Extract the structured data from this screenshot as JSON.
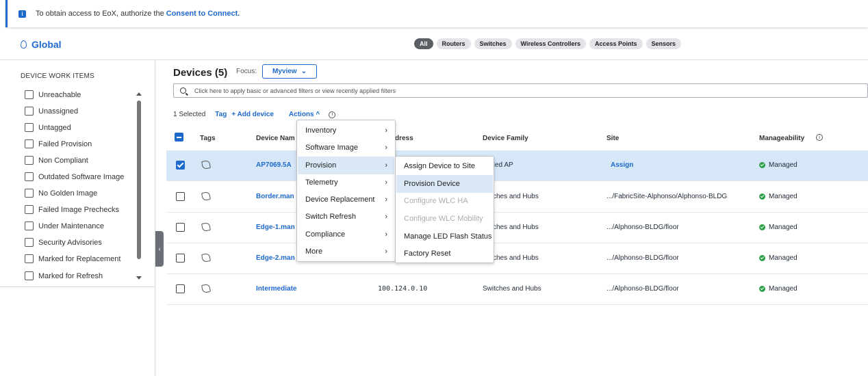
{
  "banner": {
    "text": "To obtain access to EoX, authorize the",
    "link": "Consent to Connect."
  },
  "location": {
    "label": "Global"
  },
  "filters": [
    "All",
    "Routers",
    "Switches",
    "Wireless Controllers",
    "Access Points",
    "Sensors"
  ],
  "sidebar": {
    "heading": "DEVICE WORK ITEMS",
    "items": [
      "Unreachable",
      "Unassigned",
      "Untagged",
      "Failed Provision",
      "Non Compliant",
      "Outdated Software Image",
      "No Golden Image",
      "Failed Image Prechecks",
      "Under Maintenance",
      "Security Advisories",
      "Marked for Replacement",
      "Marked for Refresh"
    ]
  },
  "main": {
    "title": "Devices (5)",
    "focus_label": "Focus:",
    "focus_value": "Myview",
    "search_placeholder": "Click here to apply basic or advanced filters or view recently applied filters",
    "selected": "1 Selected",
    "tag": "Tag",
    "add_device": "+ Add device",
    "actions": "Actions ^"
  },
  "table": {
    "headers": {
      "tags": "Tags",
      "device_name": "Device Nam",
      "ip": "dress",
      "family": "Device Family",
      "site": "Site",
      "manageability": "Manageability"
    },
    "rows": [
      {
        "name": "AP7069.5A",
        "ip": "",
        "family": "fied AP",
        "site": "Assign",
        "status": "Managed"
      },
      {
        "name": "Border.man",
        "ip": "",
        "family": "itches and Hubs",
        "site": ".../FabricSite-Alphonso/Alphonso-BLDG",
        "status": "Managed"
      },
      {
        "name": "Edge-1.man",
        "ip": "",
        "family": "itches and Hubs",
        "site": ".../Alphonso-BLDG/floor",
        "status": "Managed"
      },
      {
        "name": "Edge-2.man",
        "ip": "",
        "family": "itches and Hubs",
        "site": ".../Alphonso-BLDG/floor",
        "status": "Managed"
      },
      {
        "name": "Intermediate",
        "ip": "100.124.0.10",
        "family": "Switches and Hubs",
        "site": ".../Alphonso-BLDG/floor",
        "status": "Managed"
      }
    ]
  },
  "actions_menu": [
    "Inventory",
    "Software Image",
    "Provision",
    "Telemetry",
    "Device Replacement",
    "Switch Refresh",
    "Compliance",
    "More"
  ],
  "provision_menu": [
    "Assign Device to Site",
    "Provision Device",
    "Configure WLC HA",
    "Configure WLC Mobility",
    "Manage LED Flash Status",
    "Factory Reset"
  ],
  "colors": {
    "accent": "#1d69cc",
    "managed": "#2e9f49",
    "selected_row": "#d6e7f7"
  }
}
